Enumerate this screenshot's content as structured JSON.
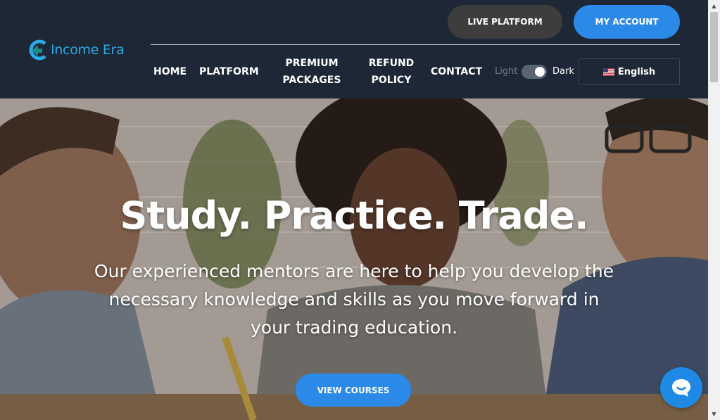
{
  "header": {
    "logo_text": "Income Era",
    "live_platform": "LIVE PLATFORM",
    "my_account": "MY ACCOUNT",
    "nav": {
      "home": "HOME",
      "platform": "PLATFORM",
      "premium_line1": "PREMIUM",
      "premium_line2": "PACKAGES",
      "refund_line1": "REFUND",
      "refund_line2": "POLICY",
      "contact": "CONTACT"
    },
    "theme": {
      "light": "Light",
      "dark": "Dark",
      "selected": "Dark"
    },
    "language": "English"
  },
  "hero": {
    "title": "Study. Practice. Trade.",
    "subtitle": "Our experienced mentors are here to help you develop the necessary knowledge and skills as you move forward in your trading education.",
    "cta": "VIEW COURSES"
  },
  "icons": {
    "logo": "income-era-logo-icon",
    "flag": "us-flag-icon",
    "chat": "chat-bubble-icon"
  },
  "colors": {
    "header_bg": "#1d2736",
    "accent_blue": "#2b8ae8",
    "logo_blue": "#2ba8e6",
    "live_btn": "#3d3d3d"
  }
}
